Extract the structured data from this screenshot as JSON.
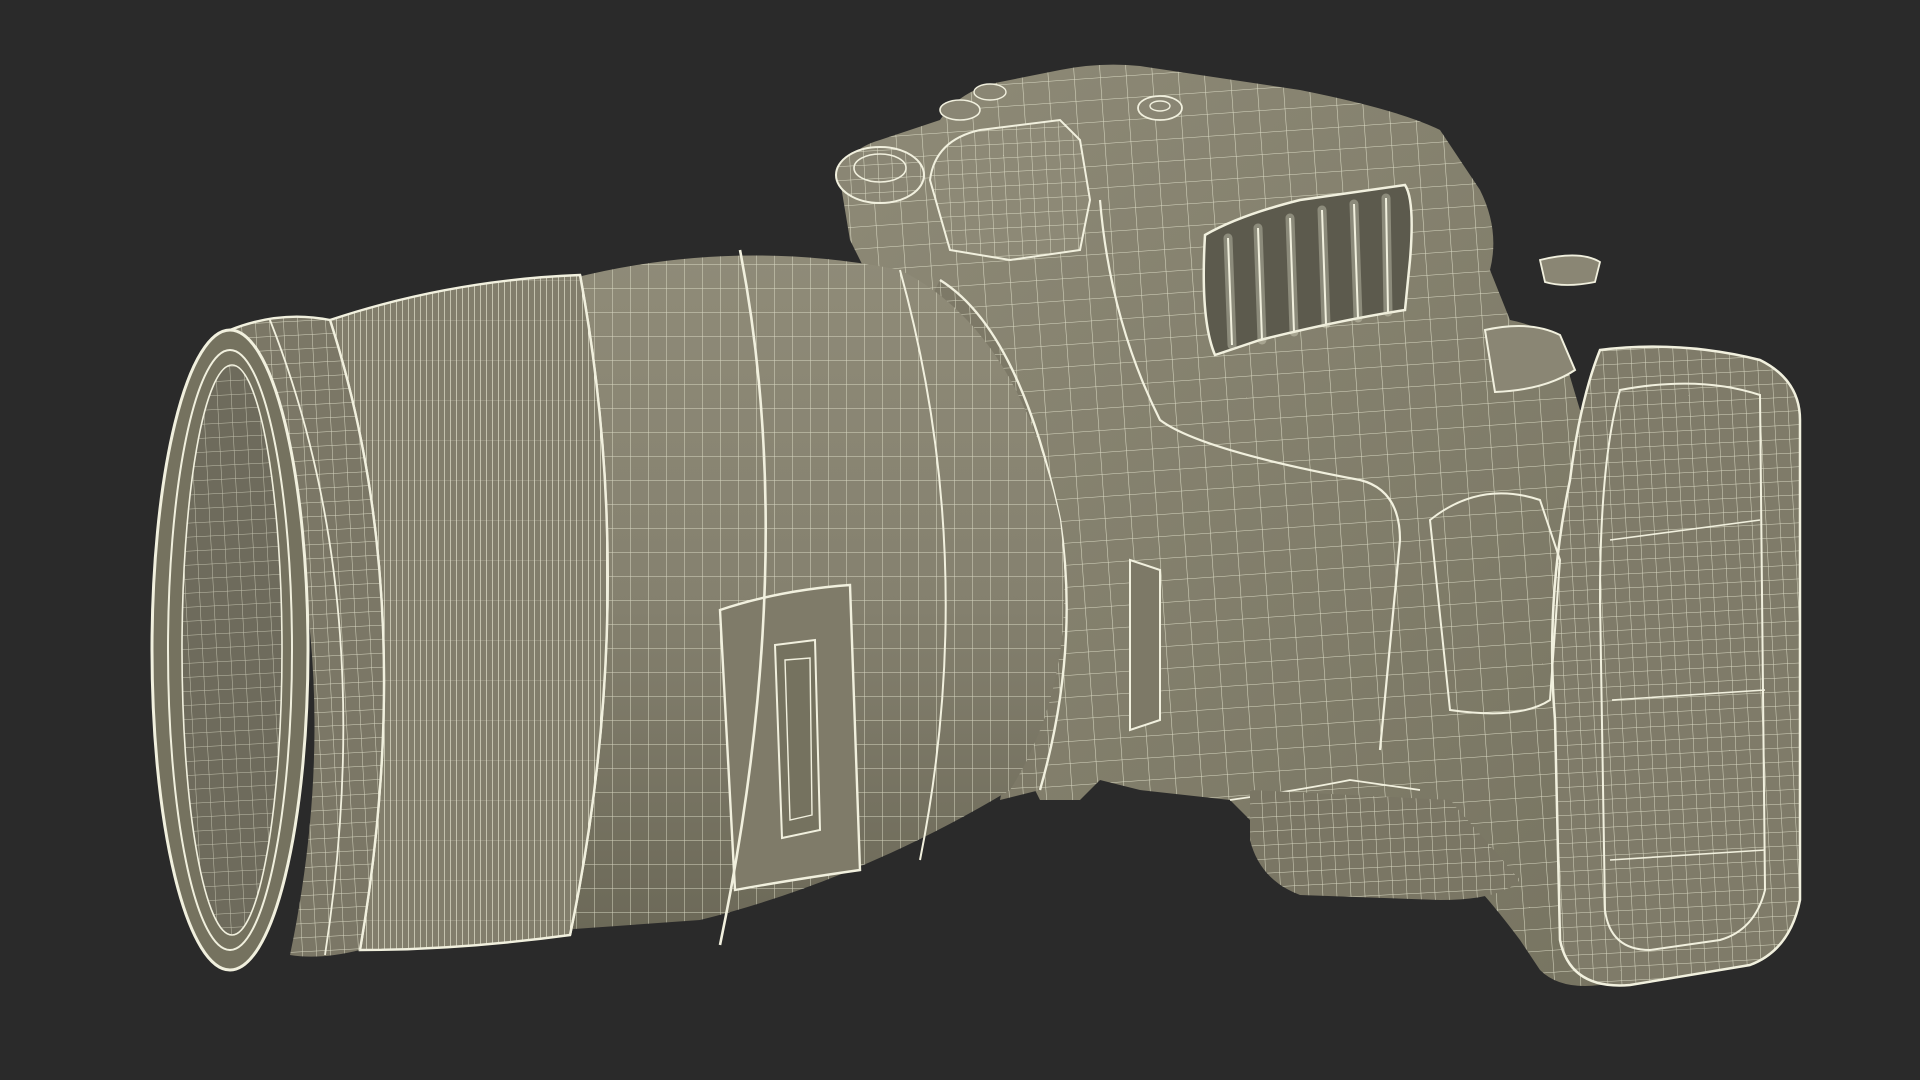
{
  "scene": {
    "subject": "camera-with-lens",
    "render_style": "wireframe",
    "colors": {
      "background": "#2a2a2a",
      "surface": "#85816f",
      "surface_light": "#9a9684",
      "surface_dark": "#6e6b5c",
      "wire": "#e7e6d0",
      "shadow_line": "#4c4a40"
    }
  }
}
